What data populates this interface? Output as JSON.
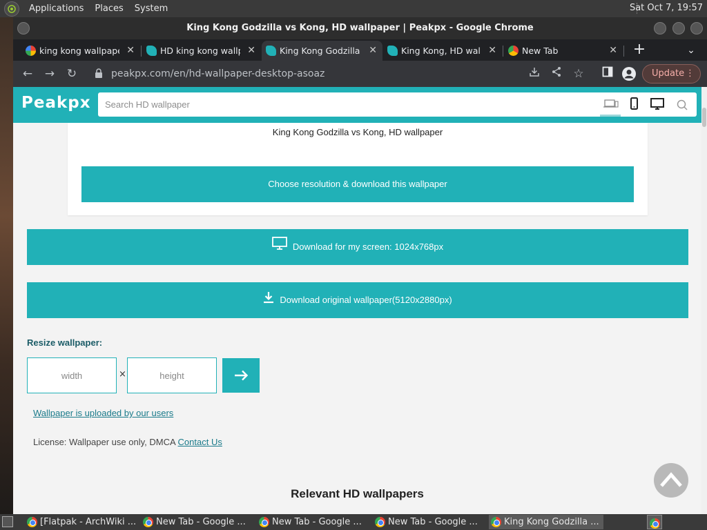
{
  "os_panel": {
    "menus": [
      "Applications",
      "Places",
      "System"
    ],
    "clock": "Sat Oct  7, 19:57"
  },
  "window": {
    "title": "King Kong Godzilla vs Kong, HD wallpaper | Peakpx - Google Chrome"
  },
  "tabs": [
    {
      "label": "king kong wallpape",
      "icon": "google-icon",
      "active": false
    },
    {
      "label": "HD king kong wallp",
      "icon": "peakpx-icon",
      "active": false
    },
    {
      "label": "King Kong Godzilla",
      "icon": "peakpx-icon",
      "active": true
    },
    {
      "label": "King Kong, HD wall",
      "icon": "peakpx-icon",
      "active": false
    },
    {
      "label": "New Tab",
      "icon": "chrome-icon",
      "active": false
    }
  ],
  "toolbar": {
    "url": "peakpx.com/en/hd-wallpaper-desktop-asoaz",
    "update_label": "Update"
  },
  "site": {
    "logo": "Peakpx",
    "search_placeholder": "Search HD wallpaper",
    "wallpaper_title": "King Kong Godzilla vs Kong, HD wallpaper",
    "choose_button": "Choose resolution & download this wallpaper",
    "download_screen": "Download for my screen: 1024x768px",
    "download_original": "Download original wallpaper(5120x2880px)",
    "resize_label": "Resize wallpaper:",
    "width_placeholder": "width",
    "height_placeholder": "height",
    "times": "×",
    "uploaded_link": "Wallpaper is uploaded by our users",
    "license_text": "License: Wallpaper use only, DMCA ",
    "contact_link": "Contact Us",
    "relevant_heading": "Relevant HD wallpapers"
  },
  "colors": {
    "brand": "#21b1b7",
    "update_bg": "#523b39",
    "link": "#1a7a8a"
  },
  "taskbar": {
    "items": [
      {
        "label": "[Flatpak - ArchWiki ...",
        "active": false
      },
      {
        "label": "New Tab - Google ...",
        "active": false
      },
      {
        "label": "New Tab - Google ...",
        "active": false
      },
      {
        "label": "New Tab - Google ...",
        "active": false
      },
      {
        "label": "King Kong Godzilla ...",
        "active": true
      }
    ]
  }
}
